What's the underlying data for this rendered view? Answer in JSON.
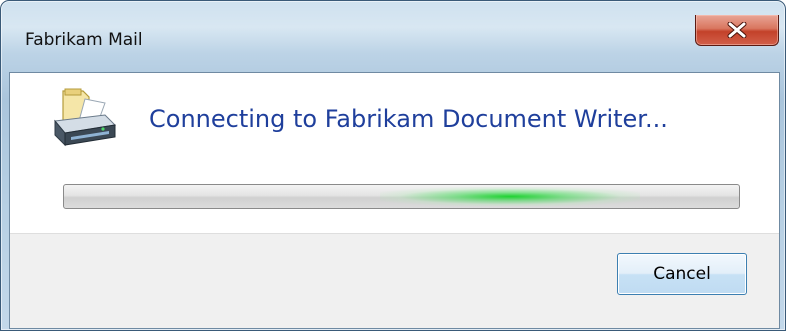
{
  "window": {
    "title": "Fabrikam Mail",
    "close_icon": "close-x-icon"
  },
  "dialog": {
    "icon": "printer-icon",
    "main_instruction": "Connecting to Fabrikam Document Writer...",
    "progress": {
      "style": "marquee",
      "glow_position_fraction": 0.66,
      "glow_color": "#1fd12f"
    }
  },
  "buttons": {
    "cancel_label": "Cancel"
  },
  "colors": {
    "instruction_text": "#1f3f9c",
    "close_button": "#c3412a"
  }
}
